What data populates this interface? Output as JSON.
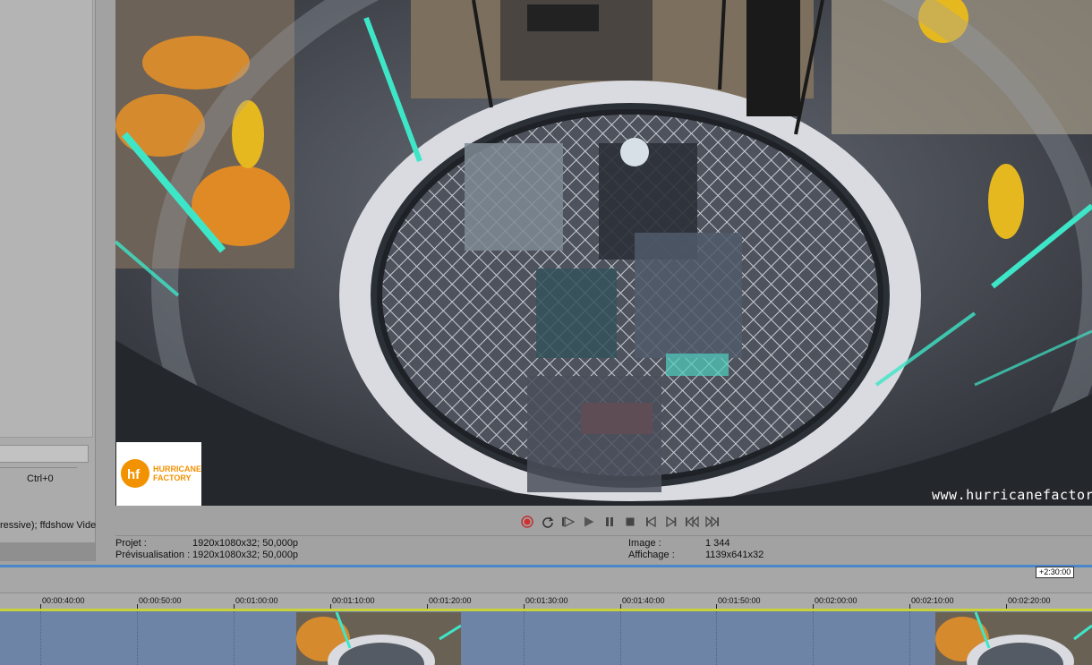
{
  "left_panel": {
    "shortcut": "Ctrl+0",
    "codec_text": "ressive); ffdshow Vide"
  },
  "video": {
    "watermark": "www.hurricanefactor",
    "logo_text_line1": "HURRICANE",
    "logo_text_line2": "FACTORY",
    "logo_mark": "hf"
  },
  "transport": [
    {
      "name": "record-icon"
    },
    {
      "name": "loop-icon"
    },
    {
      "name": "play-from-start-icon"
    },
    {
      "name": "play-icon"
    },
    {
      "name": "pause-icon"
    },
    {
      "name": "stop-icon"
    },
    {
      "name": "previous-frame-icon"
    },
    {
      "name": "next-frame-icon"
    },
    {
      "name": "step-back-icon"
    },
    {
      "name": "step-forward-icon"
    }
  ],
  "info": {
    "project_label": "Projet :",
    "project_value": "1920x1080x32; 50,000p",
    "preview_label": "Prévisualisation :",
    "preview_value": "1920x1080x32; 50,000p",
    "image_label": "Image :",
    "image_value": "1 344",
    "display_label": "Affichage :",
    "display_value": "1139x641x32"
  },
  "timeline": {
    "badge": "+2:30:00",
    "ticks": [
      "00:00:40:00",
      "00:00:50:00",
      "00:01:00:00",
      "00:01:10:00",
      "00:01:20:00",
      "00:01:30:00",
      "00:01:40:00",
      "00:01:50:00",
      "00:02:00:00",
      "00:02:10:00",
      "00:02:20:00"
    ]
  },
  "colors": {
    "accent": "#4a86c8",
    "track": "#6e84a6",
    "cursor": "#c9d23a",
    "record": "#d03030"
  }
}
